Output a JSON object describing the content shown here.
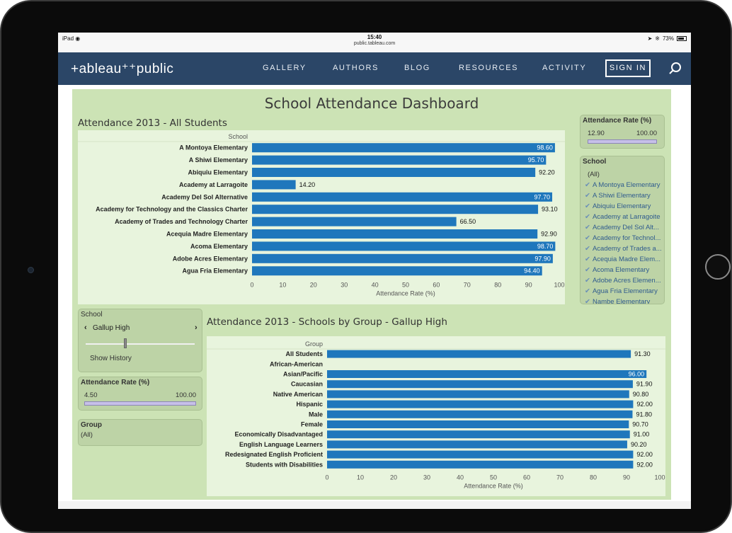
{
  "statusbar": {
    "device": "iPad",
    "wifi": "wifi-icon",
    "time": "15:40",
    "url": "public.tableau.com",
    "battery": "73%"
  },
  "nav": {
    "logo": "+ableau⁺⁺public",
    "items": [
      "GALLERY",
      "AUTHORS",
      "BLOG",
      "RESOURCES",
      "ACTIVITY"
    ],
    "signin": "SIGN IN"
  },
  "dashboard": {
    "title": "School Attendance Dashboard",
    "chart1_title": "Attendance 2013 - All Students",
    "chart2_title": "Attendance 2013 - Schools by Group - Gallup High"
  },
  "filters": {
    "rate1": {
      "title": "Attendance Rate (%)",
      "min": "12.90",
      "max": "100.00"
    },
    "school": {
      "title": "School",
      "all": "(All)",
      "items": [
        "A Montoya Elementary",
        "A Shiwi Elementary",
        "Abiquiu Elementary",
        "Academy at Larragoite",
        "Academy Del Sol Alt...",
        "Academy for Technol...",
        "Academy of Trades a...",
        "Acequia Madre Elem...",
        "Acoma Elementary",
        "Adobe Acres Elemen...",
        "Agua Fria Elementary",
        "Nambe Elementary"
      ]
    },
    "school_stepper": {
      "title": "School",
      "value": "Gallup High",
      "show_history": "Show History"
    },
    "rate2": {
      "title": "Attendance Rate (%)",
      "min": "4.50",
      "max": "100.00"
    },
    "group": {
      "title": "Group",
      "value": "(All)"
    }
  },
  "chart_data": [
    {
      "type": "bar",
      "title": "Attendance 2013 - All Students",
      "header": "School",
      "xlabel": "Attendance Rate (%)",
      "xlim": [
        0,
        100
      ],
      "ticks": [
        0,
        10,
        20,
        30,
        40,
        50,
        60,
        70,
        80,
        90,
        100
      ],
      "categories": [
        "A Montoya Elementary",
        "A Shiwi Elementary",
        "Abiquiu Elementary",
        "Academy at Larragoite",
        "Academy Del Sol Alternative",
        "Academy for Technology and the Classics Charter",
        "Academy of Trades and Technology Charter",
        "Acequia Madre Elementary",
        "Acoma Elementary",
        "Adobe Acres Elementary",
        "Agua Fria Elementary"
      ],
      "values": [
        98.6,
        95.7,
        92.2,
        14.2,
        97.7,
        93.1,
        66.5,
        92.9,
        98.7,
        97.9,
        94.4
      ],
      "labels": [
        "98.60",
        "95.70",
        "92.20",
        "14.20",
        "97.70",
        "93.10",
        "66.50",
        "92.90",
        "98.70",
        "97.90",
        "94.40"
      ],
      "label_inside": [
        true,
        true,
        false,
        false,
        true,
        false,
        false,
        false,
        true,
        true,
        true
      ]
    },
    {
      "type": "bar",
      "title": "Attendance 2013 - Schools by Group - Gallup High",
      "header": "Group",
      "xlabel": "Attendance Rate (%)",
      "xlim": [
        0,
        100
      ],
      "ticks": [
        0,
        10,
        20,
        30,
        40,
        50,
        60,
        70,
        80,
        90,
        100
      ],
      "categories": [
        "All Students",
        "African-American",
        "Asian/Pacific",
        "Caucasian",
        "Native American",
        "Hispanic",
        "Male",
        "Female",
        "Economically Disadvantaged",
        "English Language Learners",
        "Redesignated English Proficient",
        "Students with Disabilities"
      ],
      "values": [
        91.3,
        null,
        96.0,
        91.9,
        90.8,
        92.0,
        91.8,
        90.7,
        91.0,
        90.2,
        92.0,
        92.0
      ],
      "labels": [
        "91.30",
        "",
        "96.00",
        "91.90",
        "90.80",
        "92.00",
        "91.80",
        "90.70",
        "91.00",
        "90.20",
        "92.00",
        "92.00"
      ],
      "label_inside": [
        false,
        false,
        true,
        false,
        false,
        false,
        false,
        false,
        false,
        false,
        false,
        false
      ]
    }
  ]
}
